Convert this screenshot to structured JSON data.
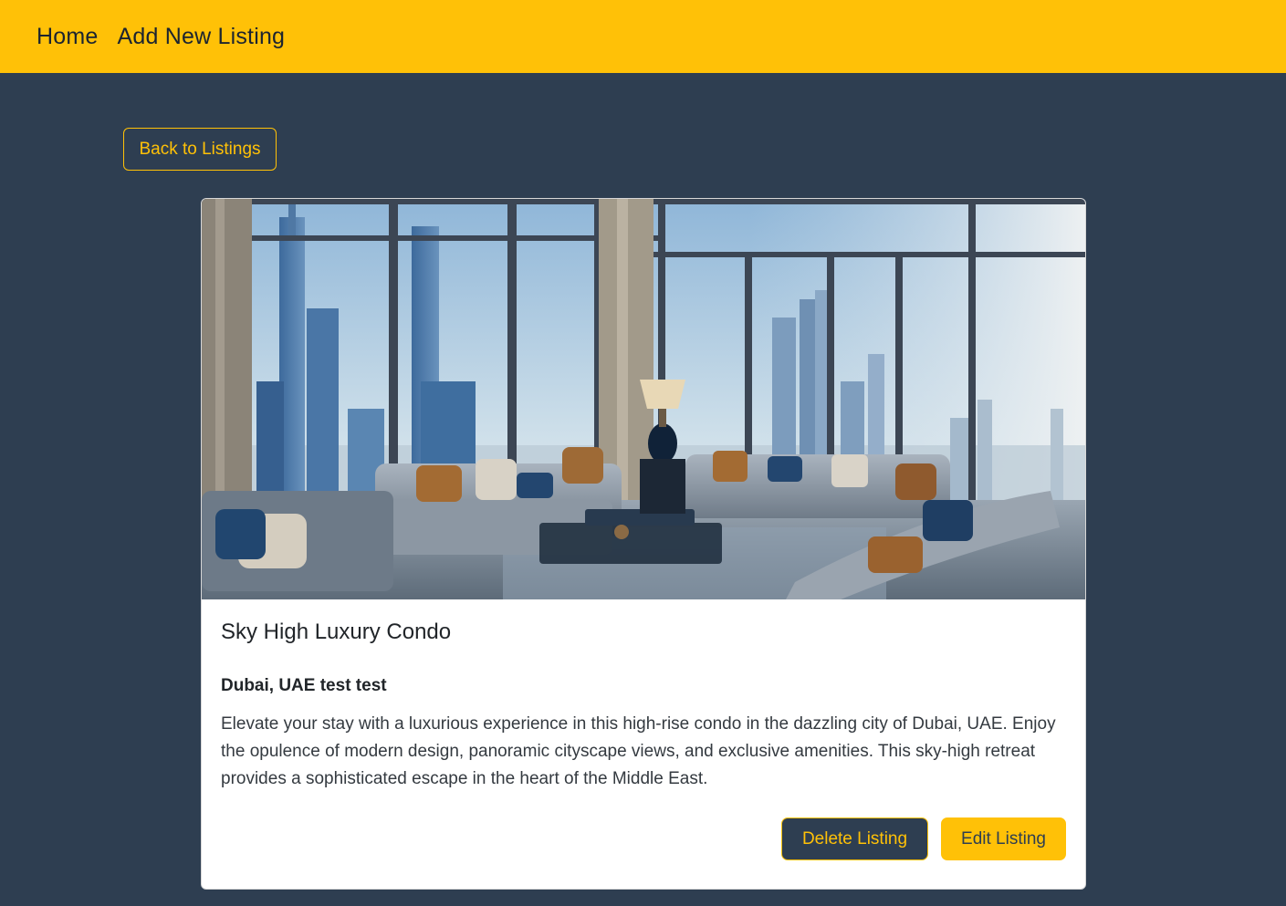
{
  "nav": {
    "home_label": "Home",
    "add_label": "Add New Listing"
  },
  "back_button": "Back to Listings",
  "listing": {
    "title": "Sky High Luxury Condo",
    "location": "Dubai, UAE test test",
    "description": "Elevate your stay with a luxurious experience in this high-rise condo in the dazzling city of Dubai, UAE. Enjoy the opulence of modern design, panoramic cityscape views, and exclusive amenities. This sky-high retreat provides a sophisticated escape in the heart of the Middle East.",
    "delete_label": "Delete Listing",
    "edit_label": "Edit Listing"
  },
  "colors": {
    "accent": "#ffc107",
    "background": "#2e3e51",
    "card": "#ffffff"
  }
}
